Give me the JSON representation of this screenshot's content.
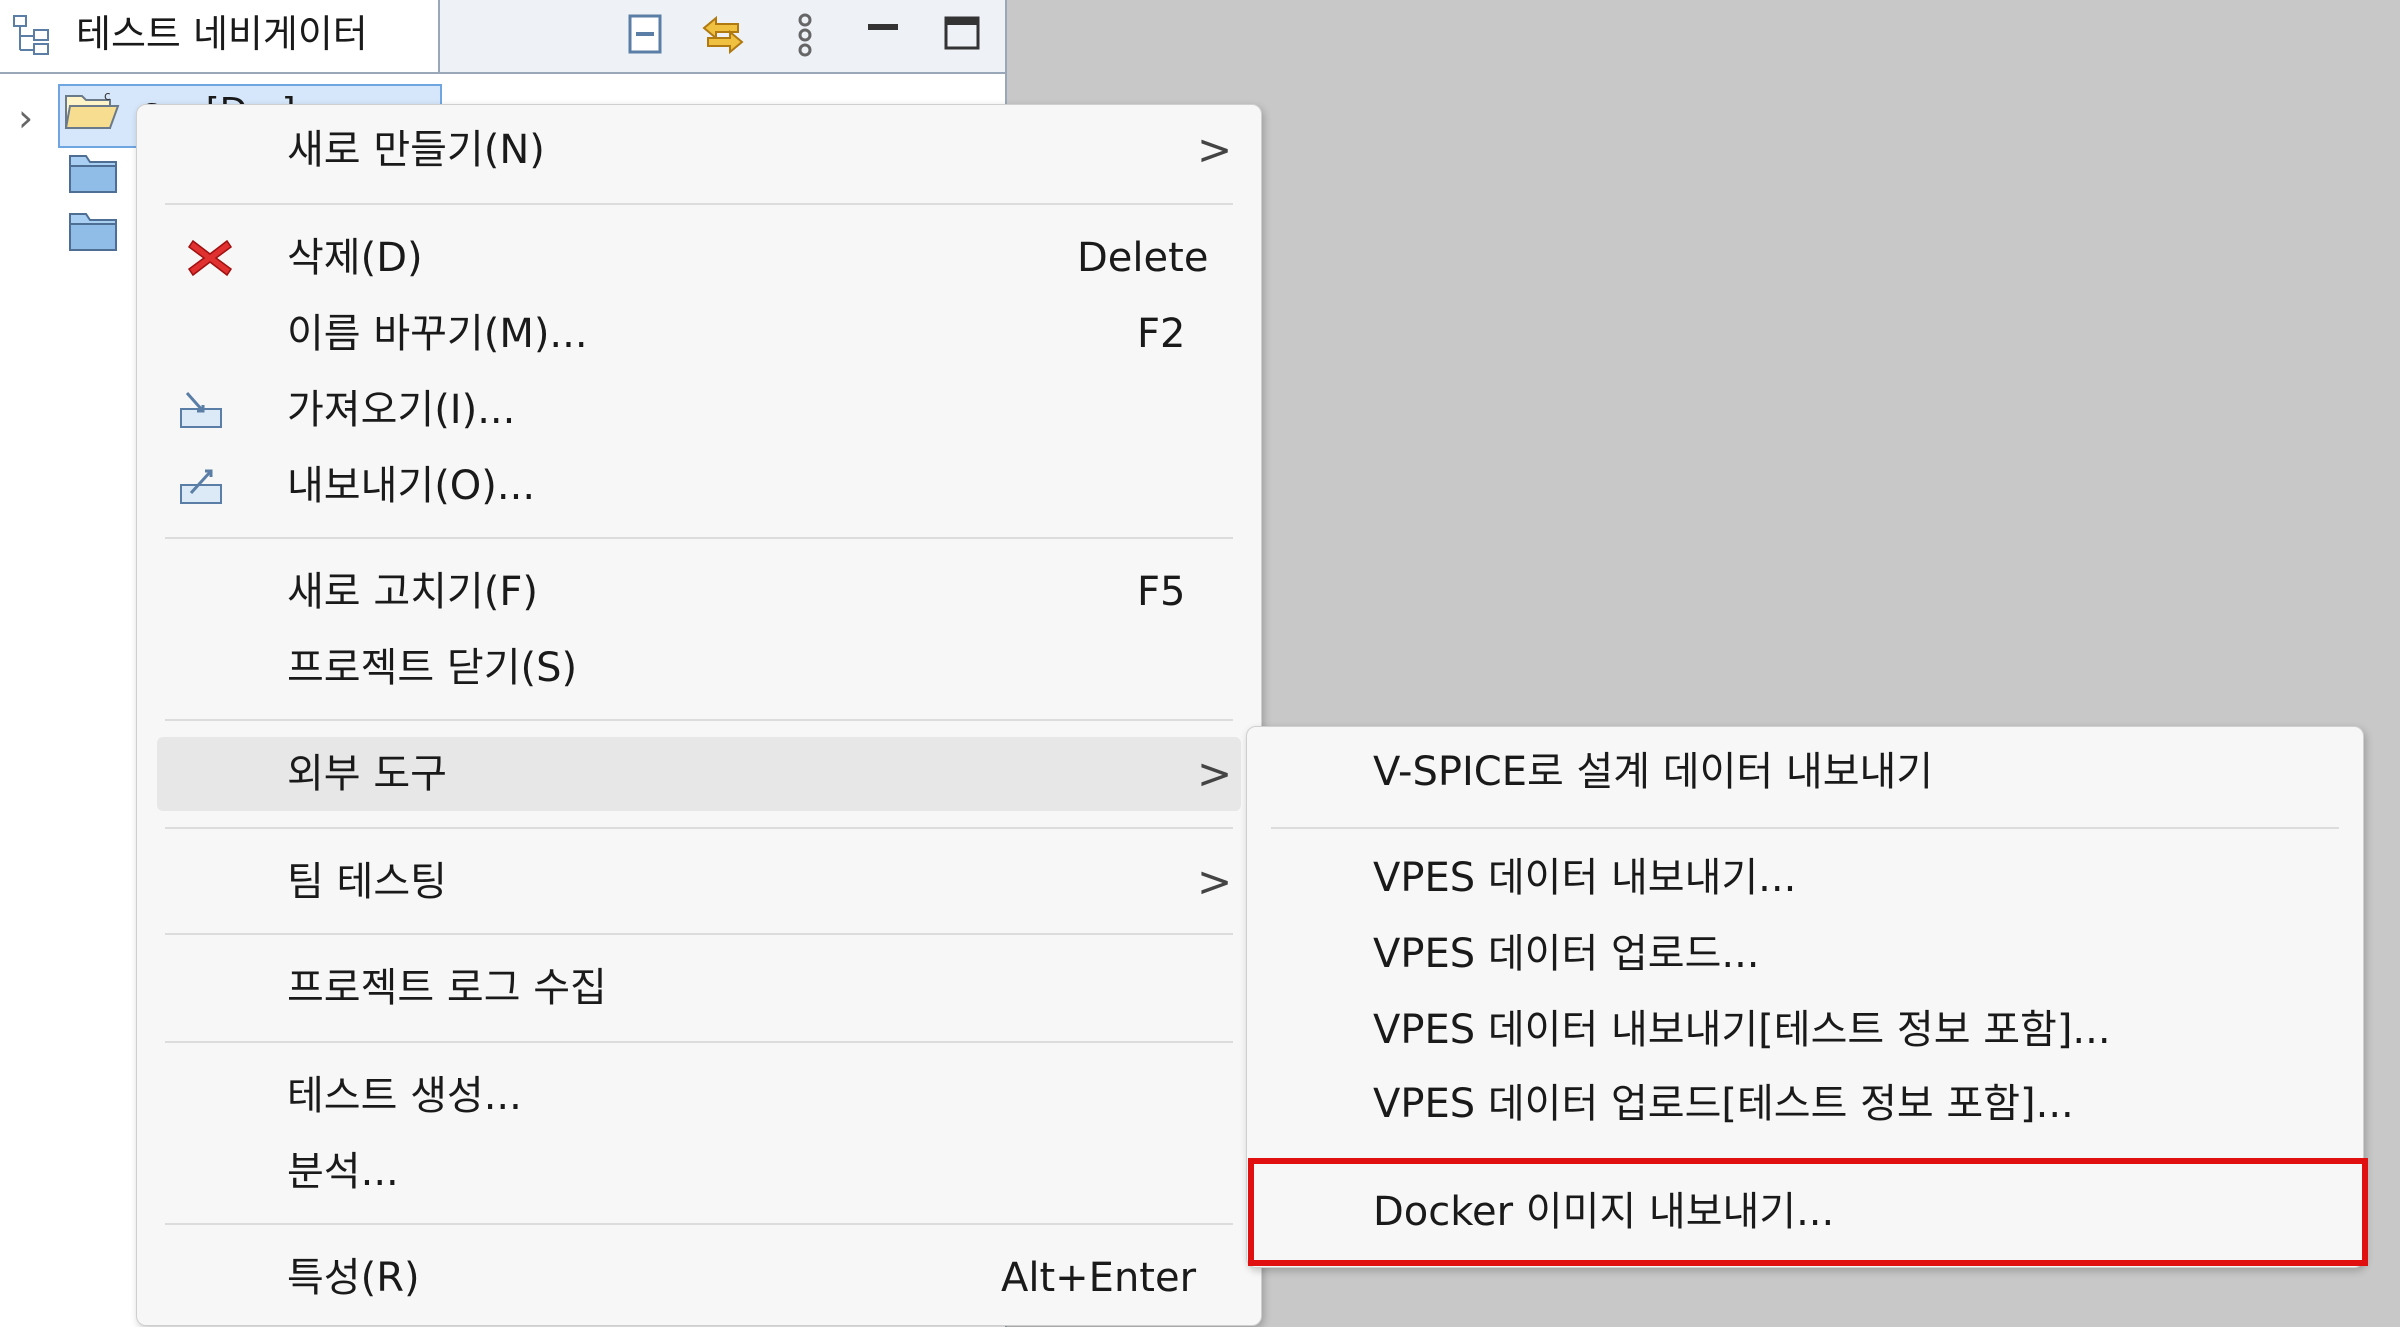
{
  "navigator": {
    "title": "테스트 네비게이터",
    "tree_selected_label": "c... [D...]"
  },
  "context_menu": {
    "new_label": "새로 만들기(N)",
    "delete_label": "삭제(D)",
    "delete_shortcut": "Delete",
    "rename_label": "이름 바꾸기(M)...",
    "rename_shortcut": "F2",
    "import_label": "가져오기(I)...",
    "export_label": "내보내기(O)...",
    "refresh_label": "새로 고치기(F)",
    "refresh_shortcut": "F5",
    "close_project_label": "프로젝트 닫기(S)",
    "external_tools_label": "외부 도구",
    "team_testing_label": "팀 테스팅",
    "collect_logs_label": "프로젝트 로그 수집",
    "create_test_label": "테스트 생성...",
    "analyze_label": "분석...",
    "properties_label": "특성(R)",
    "properties_shortcut": "Alt+Enter",
    "submenu_arrow": ">"
  },
  "submenu": {
    "vspice_export_label": "V-SPICE로 설계 데이터 내보내기",
    "vpes_export_label": "VPES 데이터 내보내기...",
    "vpes_upload_label": "VPES 데이터 업로드...",
    "vpes_export_with_test_label": "VPES 데이터 내보내기[테스트 정보 포함]...",
    "vpes_upload_with_test_label": "VPES 데이터 업로드[테스트 정보 포함]...",
    "docker_export_label": "Docker 이미지 내보내기..."
  },
  "colors": {
    "highlight": "#e01010",
    "delete_icon": "#e03030",
    "folder": "#7fb3e0"
  }
}
